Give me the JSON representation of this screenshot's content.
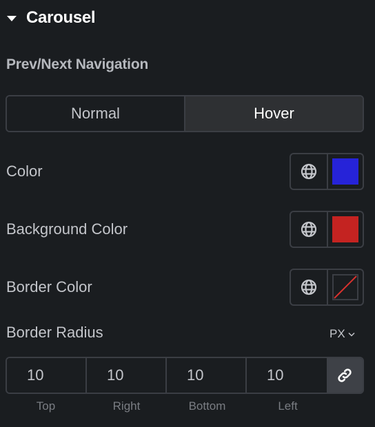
{
  "section": {
    "title": "Carousel",
    "icon": "caret-down-icon",
    "expanded": true
  },
  "subheading": "Prev/Next Navigation",
  "tabs": [
    {
      "label": "Normal",
      "active": false
    },
    {
      "label": "Hover",
      "active": true
    }
  ],
  "color_fields": [
    {
      "label": "Color",
      "value": "#2623d8",
      "global_icon": "globe-icon"
    },
    {
      "label": "Background Color",
      "value": "#c42321",
      "global_icon": "globe-icon"
    },
    {
      "label": "Border Color",
      "value": null,
      "global_icon": "globe-icon"
    }
  ],
  "border_radius": {
    "label": "Border Radius",
    "unit": "PX",
    "linked": true,
    "fields": [
      {
        "label": "Top",
        "value": "10"
      },
      {
        "label": "Right",
        "value": "10"
      },
      {
        "label": "Bottom",
        "value": "10"
      },
      {
        "label": "Left",
        "value": "10"
      }
    ]
  }
}
